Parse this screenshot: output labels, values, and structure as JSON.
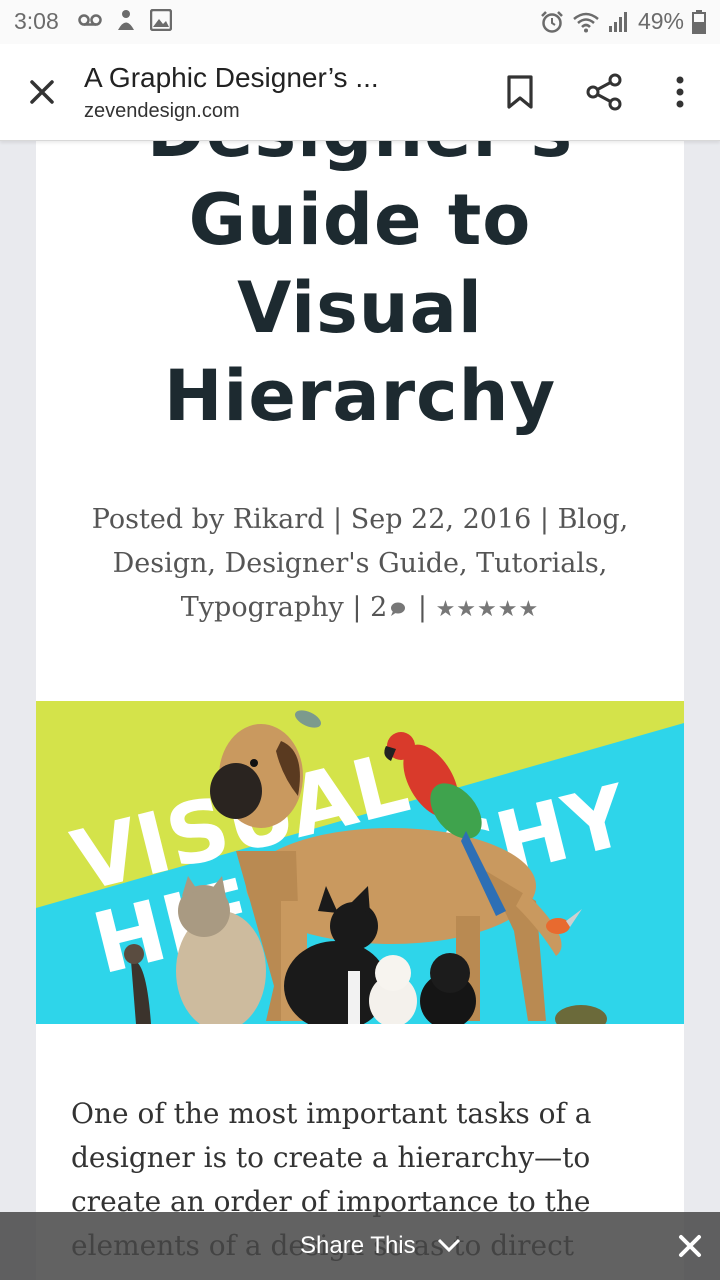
{
  "status_bar": {
    "time": "3:08",
    "battery": "49%"
  },
  "toolbar": {
    "title": "A Graphic Designer’s ...",
    "domain": "zevendesign.com"
  },
  "article": {
    "title_line1": "Designer's",
    "title_line2": "Guide to",
    "title_line3": "Visual",
    "title_line4": "Hierarchy",
    "meta": {
      "posted_by": "Posted by",
      "author": "Rikard",
      "sep1": "|",
      "date": "Sep 22, 2016",
      "sep2": "|",
      "categories": [
        "Blog,",
        "Design,",
        "Designer's Guide,",
        "Tutorials,",
        "Typography"
      ],
      "sep3": "|",
      "comments": "2",
      "sep4": "|",
      "rating_stars": "★★★★★",
      "rating": 5
    },
    "hero": {
      "text_line1": "VISUAL",
      "text_line2": "HIERARCHY"
    },
    "body": "One of the most important tasks of a designer is to create a hierarchy—to create an order of importance to the elements of a design so as to direct"
  },
  "share_bar": {
    "label": "Share This"
  },
  "colors": {
    "title": "#1d2a30",
    "hero_yellow": "#d4e34a",
    "hero_cyan": "#2ed5ea",
    "text": "#333333"
  }
}
